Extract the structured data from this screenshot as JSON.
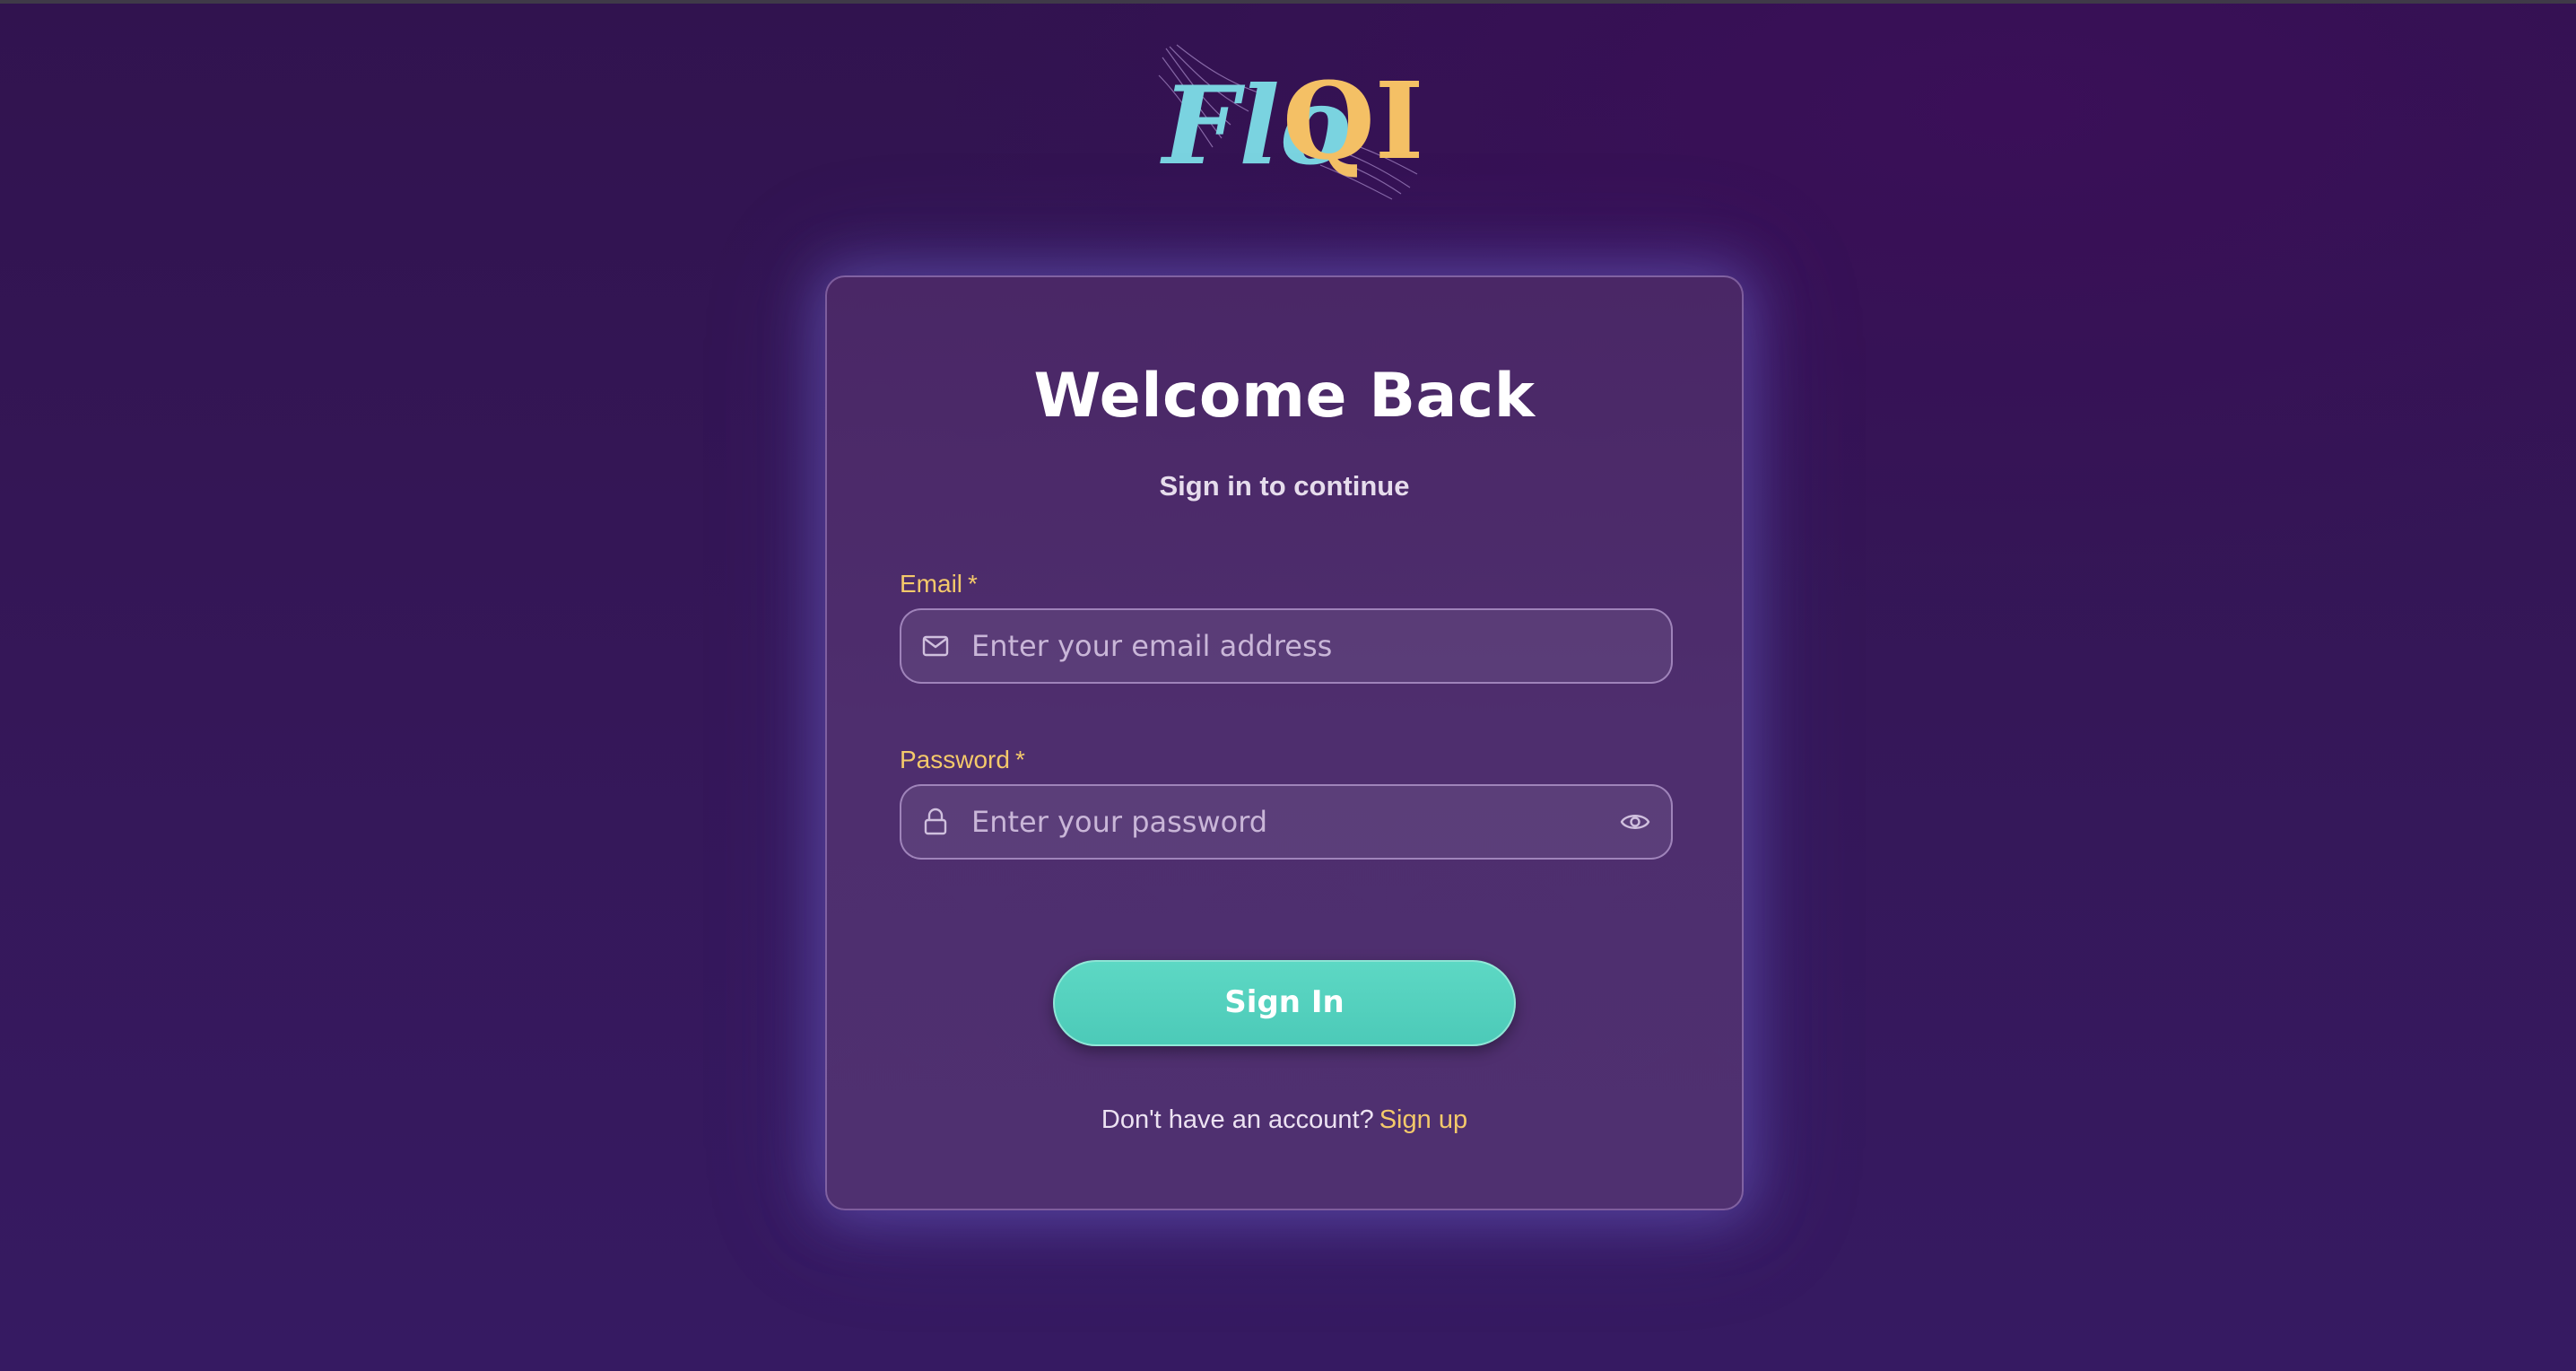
{
  "brand": {
    "logo_text_part1": "Flo",
    "logo_text_part2": "QI",
    "colors": {
      "logo_primary": "#7ad3e0",
      "logo_secondary": "#f4c065"
    }
  },
  "card": {
    "title": "Welcome Back",
    "subtitle": "Sign in to continue"
  },
  "form": {
    "email": {
      "label": "Email",
      "required_mark": "*",
      "placeholder": "Enter your email address",
      "value": "",
      "icon": "mail-icon"
    },
    "password": {
      "label": "Password",
      "required_mark": "*",
      "placeholder": "Enter your password",
      "value": "",
      "icon": "lock-icon",
      "toggle_icon": "eye-icon"
    },
    "submit_label": "Sign In"
  },
  "footer": {
    "prompt": "Don't have an account?",
    "link_label": "Sign up"
  },
  "colors": {
    "accent": "#4fcfbd",
    "label": "#f4c96a",
    "background": "#351758",
    "card": "#4d2c6c"
  }
}
